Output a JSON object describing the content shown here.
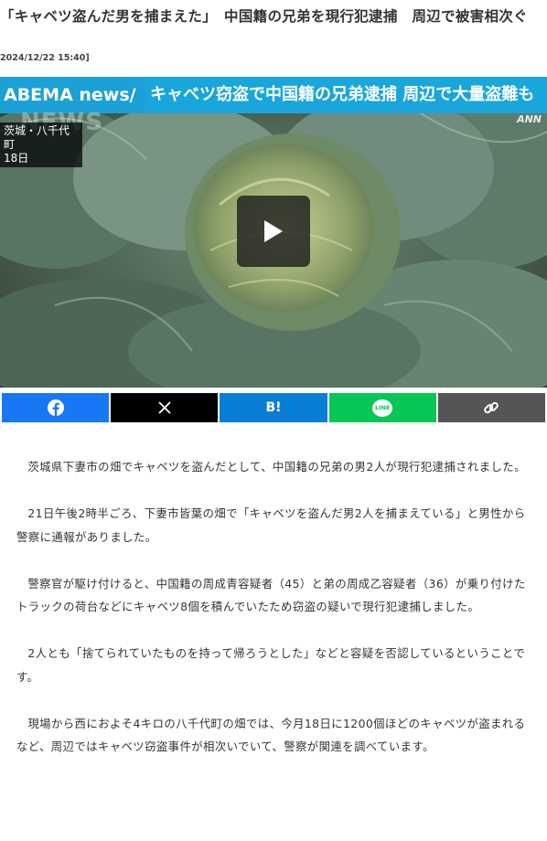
{
  "article": {
    "headline": "「キャベツ盗んだ男を捕まえた」　中国籍の兄弟を現行犯逮捕　周辺で被害相次ぐ",
    "dateline": "2024/12/22 15:40]",
    "paragraphs": [
      "茨城県下妻市の畑でキャベツを盗んだとして、中国籍の兄弟の男2人が現行犯逮捕されました。",
      "21日午後2時半ごろ、下妻市皆葉の畑で「キャベツを盗んだ男2人を捕まえている」と男性から警察に通報がありました。",
      "警察官が駆け付けると、中国籍の周成青容疑者（45）と弟の周成乙容疑者（36）が乗り付けたトラックの荷台などにキャベツ8個を積んでいたため窃盗の疑いで現行犯逮捕しました。",
      "2人とも「捨てられていたものを持って帰ろうとした」などと容疑を否認しているということです。",
      "現場から西におよそ4キロの八千代町の畑では、今月18日に1200個ほどのキャベツが盗まれるなど、周辺ではキャベツ窃盗事件が相次いでいて、警察が関連を調べています。"
    ]
  },
  "video": {
    "banner_brand": "ABEMA news/",
    "banner_text": "キャベツ窃盗で中国籍の兄弟逮捕 周辺で大量盗難も",
    "location_line1": "茨城・八千代町",
    "location_line2": "18日",
    "watermark_news": "NEWS",
    "watermark_ann": "ANN",
    "play_icon": "play-icon",
    "colors": {
      "banner": "#18a6dc",
      "overlay": "#1e1e1e"
    }
  },
  "share": {
    "buttons": [
      {
        "name": "facebook",
        "icon": "facebook-icon",
        "label": "",
        "color": "#1877f2"
      },
      {
        "name": "x",
        "icon": "x-icon",
        "label": "",
        "color": "#000000"
      },
      {
        "name": "hatena",
        "icon": "hatena-bookmark-icon",
        "label": "B!",
        "color": "#0a7ed4"
      },
      {
        "name": "line",
        "icon": "line-icon",
        "label": "LINE",
        "color": "#06c755"
      },
      {
        "name": "copy-link",
        "icon": "link-icon",
        "label": "",
        "color": "#555555"
      }
    ]
  }
}
